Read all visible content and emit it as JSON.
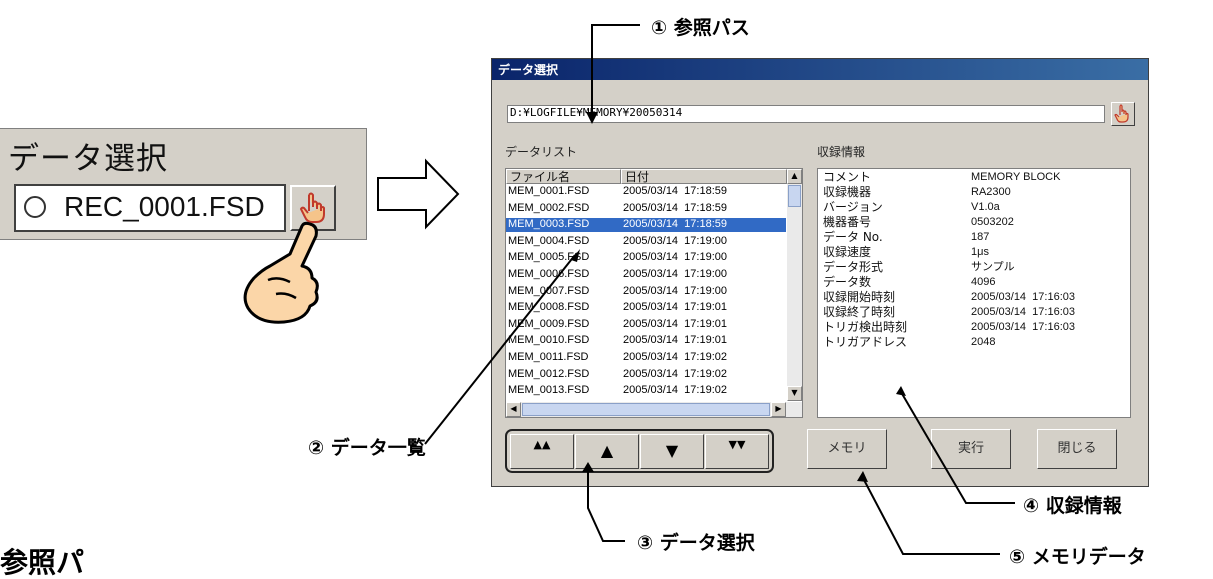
{
  "left_widget": {
    "title": "データ選択",
    "filename": "REC_0001.FSD"
  },
  "dialog": {
    "title": "データ選択",
    "path": "D:¥LOGFILE¥MEMORY¥20050314",
    "list_label": "データリスト",
    "info_label": "収録情報",
    "list_headers": [
      "ファイル名",
      "日付"
    ],
    "files": [
      {
        "name": "MEM_0001.FSD",
        "date": "2005/03/14  17:18:59"
      },
      {
        "name": "MEM_0002.FSD",
        "date": "2005/03/14  17:18:59"
      },
      {
        "name": "MEM_0003.FSD",
        "date": "2005/03/14  17:18:59"
      },
      {
        "name": "MEM_0004.FSD",
        "date": "2005/03/14  17:19:00"
      },
      {
        "name": "MEM_0005.FSD",
        "date": "2005/03/14  17:19:00"
      },
      {
        "name": "MEM_0006.FSD",
        "date": "2005/03/14  17:19:00"
      },
      {
        "name": "MEM_0007.FSD",
        "date": "2005/03/14  17:19:00"
      },
      {
        "name": "MEM_0008.FSD",
        "date": "2005/03/14  17:19:01"
      },
      {
        "name": "MEM_0009.FSD",
        "date": "2005/03/14  17:19:01"
      },
      {
        "name": "MEM_0010.FSD",
        "date": "2005/03/14  17:19:01"
      },
      {
        "name": "MEM_0011.FSD",
        "date": "2005/03/14  17:19:02"
      },
      {
        "name": "MEM_0012.FSD",
        "date": "2005/03/14  17:19:02"
      },
      {
        "name": "MEM_0013.FSD",
        "date": "2005/03/14  17:19:02"
      }
    ],
    "selected_file": "MEM_0003.FSD",
    "info": [
      {
        "key": "コメント",
        "value": "MEMORY BLOCK"
      },
      {
        "key": "収録機器",
        "value": "RA2300"
      },
      {
        "key": "バージョン",
        "value": "V1.0a"
      },
      {
        "key": "機器番号",
        "value": "0503202"
      },
      {
        "key": "データ No.",
        "value": "187"
      },
      {
        "key": "収録速度",
        "value": "1μs"
      },
      {
        "key": "データ形式",
        "value": "サンプル"
      },
      {
        "key": "データ数",
        "value": "4096"
      },
      {
        "key": "収録開始時刻",
        "value": "2005/03/14  17:16:03"
      },
      {
        "key": "収録終了時刻",
        "value": "2005/03/14  17:16:03"
      },
      {
        "key": "トリガ検出時刻",
        "value": "2005/03/14  17:16:03"
      },
      {
        "key": "トリガアドレス",
        "value": "2048"
      }
    ],
    "nav_buttons": [
      "▲▲",
      "▲",
      "▼",
      "▼▼"
    ],
    "buttons": {
      "memory": "メモリ",
      "run": "実行",
      "close": "閉じる"
    }
  },
  "callouts": {
    "c1": "① 参照パス",
    "c2": "② データ一覧",
    "c3": "③ データ選択",
    "c4": "④ 収録情報",
    "c5": "⑤ メモリデータ"
  },
  "footer_partial": "参照パ",
  "colors": {
    "selection": "#316ac5",
    "titlebar": "#0a246a",
    "dialog_bg": "#d4d0c8"
  },
  "icons": [
    "pointing-hand-icon",
    "browse-hand-icon",
    "circle-icon",
    "big-arrow-icon"
  ]
}
